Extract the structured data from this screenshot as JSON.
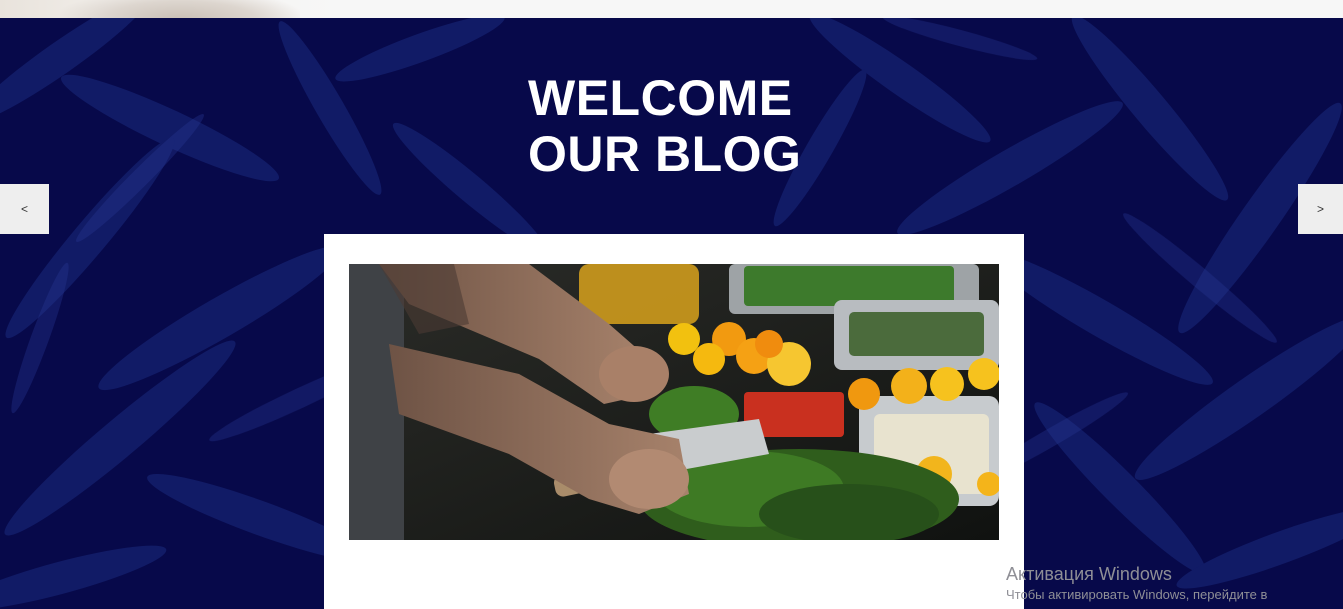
{
  "hero": {
    "title_line1": "WELCOME",
    "title_line2": "OUR BLOG",
    "background_color": "#07094a"
  },
  "slider": {
    "prev_label": "<",
    "next_label": ">"
  },
  "card": {
    "image_icon": "food-prep-photo"
  },
  "os_watermark": {
    "title": "Активация Windows",
    "subtitle": "Чтобы активировать Windows, перейдите в"
  }
}
